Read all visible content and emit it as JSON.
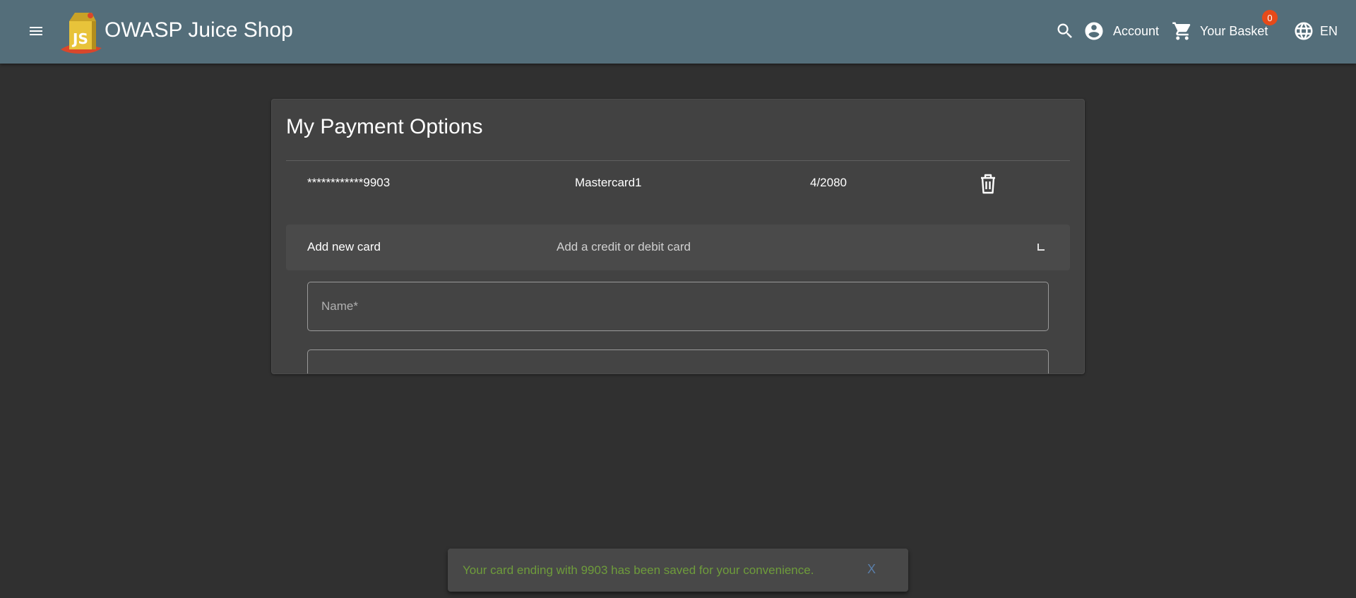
{
  "header": {
    "app_title": "OWASP Juice Shop",
    "account_label": "Account",
    "basket_label": "Your Basket",
    "basket_count": "0",
    "language_label": "EN",
    "colors": {
      "toolbar": "#546e7a",
      "badge": "#e64a19"
    },
    "icons": [
      "menu-icon",
      "juice-shop-logo",
      "search-icon",
      "account-circle-icon",
      "cart-icon",
      "language-icon"
    ]
  },
  "payment": {
    "title": "My Payment Options",
    "cards": [
      {
        "number": "************9903",
        "name": "Mastercard1",
        "expiry": "4/2080"
      }
    ],
    "add_panel": {
      "title": "Add new card",
      "description": "Add a credit or debit card"
    },
    "form": {
      "name_placeholder": "Name*"
    }
  },
  "snackbar": {
    "message": "Your card ending with 9903 has been saved for your convenience.",
    "close_label": "X",
    "colors": {
      "message": "#6e9c3b",
      "close": "#5a7ea8"
    }
  }
}
